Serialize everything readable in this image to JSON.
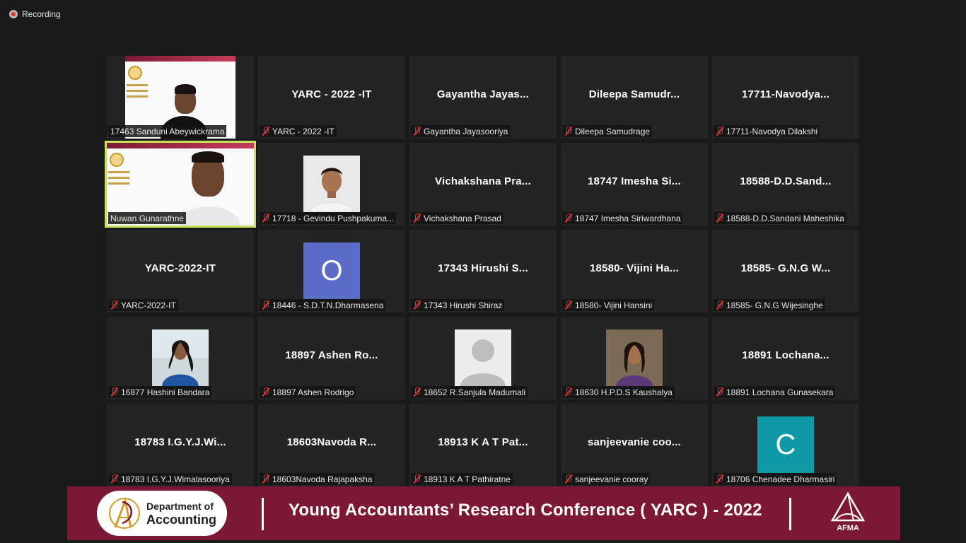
{
  "recording": {
    "label": "Recording"
  },
  "tiles": [
    {
      "label": "17463 Sanduni Abeywickrama",
      "muted": false,
      "type": "video",
      "display_name": ""
    },
    {
      "label": "YARC - 2022 -IT",
      "muted": true,
      "type": "name",
      "display_name": "YARC - 2022 -IT"
    },
    {
      "label": "Gayantha Jayasooriya",
      "muted": true,
      "type": "name",
      "display_name": "Gayantha  Jayas..."
    },
    {
      "label": "Dileepa Samudrage",
      "muted": true,
      "type": "name",
      "display_name": "Dileepa  Samudr..."
    },
    {
      "label": "17711-Navodya Dilakshi",
      "muted": true,
      "type": "name",
      "display_name": "17711-Navodya..."
    },
    {
      "label": "Nuwan Gunarathne",
      "muted": false,
      "type": "video-active",
      "display_name": ""
    },
    {
      "label": "17718 - Gevindu Pushpakuma...",
      "muted": true,
      "type": "photo",
      "display_name": ""
    },
    {
      "label": "Vichakshana Prasad",
      "muted": true,
      "type": "name",
      "display_name": "Vichakshana  Pra..."
    },
    {
      "label": "18747 Imesha Siriwardhana",
      "muted": true,
      "type": "name",
      "display_name": "18747  Imesha  Si..."
    },
    {
      "label": "18588-D.D.Sandani Maheshika",
      "muted": true,
      "type": "name",
      "display_name": "18588-D.D.Sand..."
    },
    {
      "label": "YARC-2022-IT",
      "muted": true,
      "type": "name",
      "display_name": "YARC-2022-IT"
    },
    {
      "label": "18446 - S.D.T.N.Dharmasena",
      "muted": true,
      "type": "initial",
      "initial": "O",
      "color": "#5b6bc7",
      "display_name": ""
    },
    {
      "label": "17343 Hirushi Shiraz",
      "muted": true,
      "type": "name",
      "display_name": "17343  Hirushi  S..."
    },
    {
      "label": "18580- Vijini Hansini",
      "muted": true,
      "type": "name",
      "display_name": "18580-  Vijini  Ha..."
    },
    {
      "label": "18585- G.N.G Wijesinghe",
      "muted": true,
      "type": "name",
      "display_name": "18585-  G.N.G  W..."
    },
    {
      "label": "16877 Hashini Bandara",
      "muted": true,
      "type": "photo",
      "display_name": ""
    },
    {
      "label": "18897 Ashen Rodrigo",
      "muted": true,
      "type": "name",
      "display_name": "18897  Ashen  Ro..."
    },
    {
      "label": "18652 R.Sanjula Madumali",
      "muted": true,
      "type": "placeholder",
      "display_name": ""
    },
    {
      "label": "18630 H.P.D.S Kaushalya",
      "muted": true,
      "type": "photo",
      "display_name": ""
    },
    {
      "label": "18891 Lochana Gunasekara",
      "muted": true,
      "type": "name",
      "display_name": "18891  Lochana..."
    },
    {
      "label": "18783 I.G.Y.J.Wimalasooriya",
      "muted": true,
      "type": "name",
      "display_name": "18783  I.G.Y.J.Wi..."
    },
    {
      "label": "18603Navoda Rajapaksha",
      "muted": true,
      "type": "name",
      "display_name": "18603Navoda  R..."
    },
    {
      "label": "18913 K A T Pathiratne",
      "muted": true,
      "type": "name",
      "display_name": "18913  K  A  T  Pat..."
    },
    {
      "label": "sanjeevanie cooray",
      "muted": true,
      "type": "name",
      "display_name": "sanjeevanie  coo..."
    },
    {
      "label": "18706 Chenadee Dharmasiri",
      "muted": true,
      "type": "initial",
      "initial": "C",
      "color": "#0f9aa6",
      "display_name": ""
    }
  ],
  "banner": {
    "logo_line1": "Department of",
    "logo_line2": "Accounting",
    "title": "Young Accountants’ Research Conference ( YARC ) - 2022",
    "afma_text": "AFMA"
  },
  "colors": {
    "banner": "#7c1835",
    "active_outline": "#c4e35a",
    "tile_bg": "#242424"
  }
}
